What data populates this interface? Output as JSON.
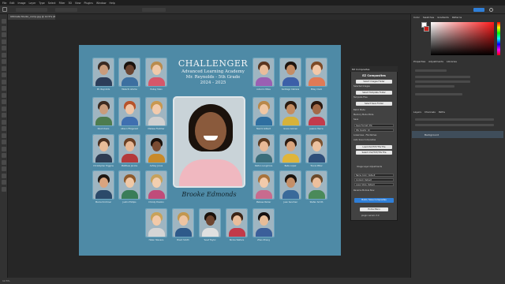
{
  "menu": [
    "File",
    "Edit",
    "Image",
    "Layer",
    "Type",
    "Select",
    "Filter",
    "3D",
    "View",
    "Plugins",
    "Window",
    "Help"
  ],
  "document_tab": "Ultimate Studio_comp.jpg @ 12.5% (RGB/8)",
  "status_zoom": "12.5%",
  "composite": {
    "title": "CHALLENGER",
    "subtitle1": "Advanced Learning Academy",
    "subtitle2": "Mr. Reynolds - 5th Grade",
    "year": "2024 - 2025",
    "featured_name": "Brooke Edmonds",
    "students_left": [
      {
        "name": "Mr. Reynolds",
        "skin": "#c99c7c",
        "hair": "#3a2a22",
        "shirt": "#2c3e5a"
      },
      {
        "name": "Malachi Adams",
        "skin": "#6b4532",
        "hair": "#1a120d",
        "shirt": "#3c6fa0"
      },
      {
        "name": "Hailey Stein",
        "skin": "#f0c9a9",
        "hair": "#b98c4f",
        "shirt": "#d6576a"
      },
      {
        "name": "Noah Davis",
        "skin": "#c99c7c",
        "hair": "#3b2a20",
        "shirt": "#4d7c4f"
      },
      {
        "name": "Allison Fitzgerald",
        "skin": "#f1c6a6",
        "hair": "#b8532a",
        "shirt": "#3f6fb0"
      },
      {
        "name": "Melissa Fletcher",
        "skin": "#f2cbad",
        "hair": "#c99850",
        "shirt": "#d0d0d0"
      },
      {
        "name": "Christopher Higgins",
        "skin": "#e9bc98",
        "hair": "#4a2f20",
        "shirt": "#2e3c52"
      },
      {
        "name": "Matthew Jacobs",
        "skin": "#e7b895",
        "hair": "#6a4024",
        "shirt": "#b43a3a"
      },
      {
        "name": "Ashley Jones",
        "skin": "#7a4c33",
        "hair": "#1a110c",
        "shirt": "#c88a2a"
      },
      {
        "name": "Marcel Kirchner",
        "skin": "#d9a47f",
        "hair": "#1e1712",
        "shirt": "#2b4a6a"
      },
      {
        "name": "Justin Phillips",
        "skin": "#f0c8a6",
        "hair": "#8d5a2b",
        "shirt": "#3a7d58"
      },
      {
        "name": "Christy Preston",
        "skin": "#f3cfb0",
        "hair": "#c7a25c",
        "shirt": "#c04c7a"
      }
    ],
    "students_right": [
      {
        "name": "Autumn Miles",
        "skin": "#e9bd9b",
        "hair": "#5a351f",
        "shirt": "#9a5fb3"
      },
      {
        "name": "Santiago Cabrera",
        "skin": "#c48d66",
        "hair": "#1e140e",
        "shirt": "#3c5fa8"
      },
      {
        "name": "Miley Clark",
        "skin": "#f2c8a8",
        "hair": "#7d4a26",
        "shirt": "#e07a56"
      },
      {
        "name": "Naomi Gilbert",
        "skin": "#f0c7a4",
        "hair": "#b9884a",
        "shirt": "#2f6fa0"
      },
      {
        "name": "Grace Gomez",
        "skin": "#c48c62",
        "hair": "#2a1a10",
        "shirt": "#d6b23a"
      },
      {
        "name": "Jessica Harris",
        "skin": "#a36a48",
        "hair": "#2a180f",
        "shirt": "#c33b4c"
      },
      {
        "name": "Dalton Longmore",
        "skin": "#e8b996",
        "hair": "#5c3a20",
        "shirt": "#3b6d7a"
      },
      {
        "name": "Bella Lopez",
        "skin": "#d9a57e",
        "hair": "#2c1b11",
        "shirt": "#e0b53a"
      },
      {
        "name": "Travis Miller",
        "skin": "#edc2a0",
        "hair": "#7b5230",
        "shirt": "#2f4f7a"
      },
      {
        "name": "Melissa Parker",
        "skin": "#f2caab",
        "hair": "#a8733c",
        "shirt": "#c86b8e"
      },
      {
        "name": "Juan Sanchez",
        "skin": "#c58f68",
        "hair": "#1b120c",
        "shirt": "#3a6a9a"
      },
      {
        "name": "Stefan Smith",
        "skin": "#ecbf9c",
        "hair": "#6a4a2b",
        "shirt": "#4a8a5a"
      }
    ],
    "students_bottom": [
      {
        "name": "Helen Stevens",
        "skin": "#f2c9a8",
        "hair": "#c8a25a",
        "shirt": "#d5d5d5"
      },
      {
        "name": "Brent Smith",
        "skin": "#edc4a2",
        "hair": "#c2974f",
        "shirt": "#2e5a8a"
      },
      {
        "name": "Yusuf Taylor",
        "skin": "#6e4530",
        "hair": "#1a100a",
        "shirt": "#e0e0e0"
      },
      {
        "name": "Nicole Walters",
        "skin": "#e9bd9a",
        "hair": "#3b2416",
        "shirt": "#c23a4a"
      },
      {
        "name": "Zhao Zhang",
        "skin": "#e6bc98",
        "hair": "#151010",
        "shirt": "#3b5f9a"
      }
    ]
  },
  "right_panels": {
    "color_tabs": [
      "Color",
      "Swatches",
      "Gradients",
      "Patterns"
    ],
    "properties_tabs": [
      "Properties",
      "Adjustments",
      "Libraries"
    ],
    "layers_tabs": [
      "Layers",
      "Channels",
      "Paths"
    ],
    "layer_name": "Background"
  },
  "plugin": {
    "header": "EZ Composites",
    "title": "EZ Composites",
    "select_images_folder": "Select Images Folder",
    "selected_images_label": "Selected Images",
    "select_template_button": "Select Template Folder",
    "template_files_label": "Template Files",
    "select_save_folder": "Select Save Folder",
    "batch_mode": "Batch Mode",
    "memory_mode": "Memory Mode Mode",
    "save_label": "Save",
    "file_format": "Save Format: JPG",
    "quality": "JPG Quality: 10",
    "lowercase": "Lowercase - File Names",
    "auto_save": "Auto Save Composites",
    "load_button": "Load CSV/TXT/TSV File",
    "select_csv_button": "Select CSV/TXT/TSV File",
    "image_adjustments_label": "Image Layer Adjustments",
    "dropdowns": [
      "Name Color: Default",
      "Content: Default",
      "Layer Style: Default"
    ],
    "rename_layers": "Rename Module Now",
    "build_button": "Build / Save Composites",
    "home_button": "Home Menu",
    "footer": "plugin version 3.0"
  }
}
